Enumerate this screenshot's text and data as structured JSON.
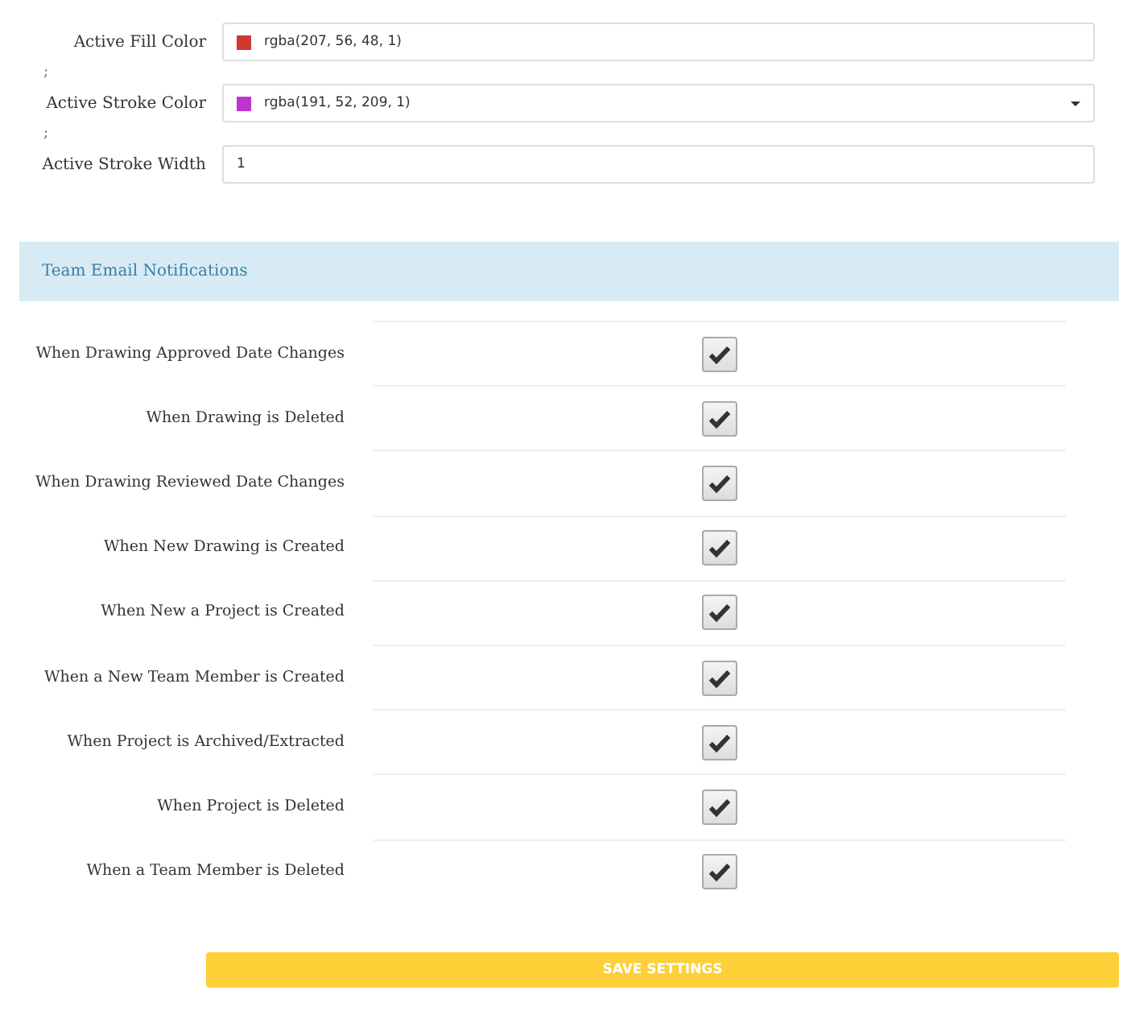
{
  "fields": [
    {
      "kind": "color",
      "label": "Active Fill Color",
      "value": "rgba(207, 56, 48, 1)",
      "color": "#cf3830",
      "dropdown": false
    },
    {
      "kind": "color",
      "prefix": ";",
      "label": "Active Stroke Color",
      "value": "rgba(191, 52, 209, 1)",
      "color": "#bf34d1",
      "dropdown": true
    },
    {
      "kind": "text",
      "prefix": ";",
      "label": "Active Stroke Width",
      "value": "1"
    }
  ],
  "section": {
    "title": "Team Email Notifications"
  },
  "notifications": [
    {
      "label": "When Drawing Approved Date Changes",
      "checked": true
    },
    {
      "label": "When Drawing is Deleted",
      "checked": true
    },
    {
      "label": "When Drawing Reviewed Date Changes",
      "checked": true
    },
    {
      "label": "When New Drawing is Created",
      "checked": true
    },
    {
      "label": "When New a Project is Created",
      "checked": true
    },
    {
      "label": "When a New Team Member is Created",
      "checked": true
    },
    {
      "label": "When Project is Archived/Extracted",
      "checked": true
    },
    {
      "label": "When Project is Deleted",
      "checked": true
    },
    {
      "label": "When a Team Member is Deleted",
      "checked": true
    }
  ],
  "save_button": "SAVE SETTINGS"
}
